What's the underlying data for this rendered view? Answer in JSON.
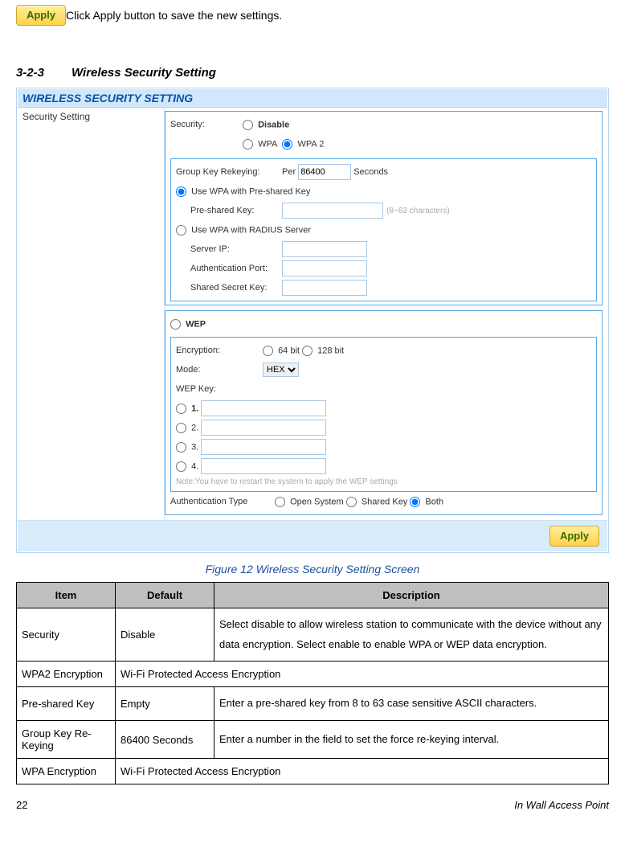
{
  "top": {
    "apply_btn": "Apply",
    "apply_text": " Click Apply button to save the new settings."
  },
  "section": {
    "num": "3-2-3",
    "title": "Wireless Security Setting"
  },
  "panel": {
    "header": "WIRELESS SECURITY SETTING",
    "left_label": "Security Setting",
    "security_label": "Security:",
    "opt_disable": "Disable",
    "opt_wpa": "WPA",
    "opt_wpa2": "WPA 2",
    "gkr_label": "Group Key Rekeying:",
    "gkr_prefix": "Per",
    "gkr_value": "86400",
    "gkr_suffix": "Seconds",
    "psk_radio": "Use WPA with Pre-shared Key",
    "psk_label": "Pre-shared Key:",
    "psk_hint": "(8~63 characters)",
    "radius_radio": "Use WPA with RADIUS Server",
    "serverip_label": "Server IP:",
    "authport_label": "Authentication Port:",
    "sskey_label": "Shared Secret Key:",
    "wep_label": "WEP",
    "enc_label": "Encryption:",
    "enc_64": "64 bit",
    "enc_128": "128 bit",
    "mode_label": "Mode:",
    "mode_opt": "HEX",
    "wepkey_label": "WEP Key:",
    "k1": "1.",
    "k2": "2.",
    "k3": "3.",
    "k4": "4.",
    "note": "Note:You have to restart the system to apply the WEP settings",
    "auth_label": "Authentication Type",
    "auth_open": "Open System",
    "auth_shared": "Shared Key",
    "auth_both": "Both",
    "foot_apply": "Apply"
  },
  "caption": "Figure 12 Wireless Security Setting Screen",
  "table": {
    "h1": "Item",
    "h2": "Default",
    "h3": "Description",
    "rows": [
      {
        "c1": "Security",
        "c2": "Disable",
        "c3": "Select disable to allow wireless station to communicate with the device without any data encryption. Select enable to enable WPA or WEP data encryption."
      },
      {
        "c1": "WPA2 Encryption",
        "c2": "",
        "c3": "Wi-Fi Protected Access Encryption"
      },
      {
        "c1": "Pre-shared Key",
        "c2": "Empty",
        "c3": "Enter a pre-shared key from 8 to 63 case sensitive ASCII characters."
      },
      {
        "c1": "Group Key Re-Keying",
        "c2": "86400 Seconds",
        "c3": "Enter a number in the field to set the force re-keying interval."
      },
      {
        "c1": "WPA Encryption",
        "c2": "",
        "c3": "Wi-Fi Protected Access Encryption"
      }
    ]
  },
  "footer": {
    "page": "22",
    "title": "In Wall Access Point"
  }
}
